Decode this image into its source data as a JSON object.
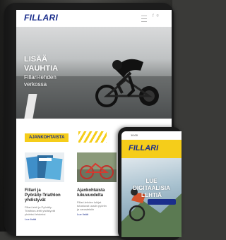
{
  "tablet": {
    "logo": "FILLARI",
    "social_icons": "f ⌾",
    "hero": {
      "title_line1": "LISÄÄ",
      "title_line2": "VAUHTIA",
      "subtitle_line1": "Fillari-lehden",
      "subtitle_line2": "verkossa"
    },
    "section_tag": "AJANKOHTAISTA",
    "cards": [
      {
        "title_line1": "Fillari ja",
        "title_line2": "Pyöräily-Triathlon",
        "title_line3": "yhdistyvät",
        "meta": "",
        "text_line1": "Fillari-lehti ja Pyöräily-",
        "text_line2": "Triathlon-lehti yhdistyvät",
        "text_line3": "yhdeksi lehdeksi",
        "link": "Lue lisää"
      },
      {
        "title_line1": "Ajankohtaista",
        "title_line2": "lukuvuodelta",
        "title_line3": "",
        "meta": "",
        "text_line1": "Fillari-lehden lukijat",
        "text_line2": "tutustuvat uusiin pyöriin",
        "text_line3": "ja varusteisiin",
        "link": "Lue lisää"
      }
    ]
  },
  "phone": {
    "status_time": "10:00",
    "logo": "FILLARI",
    "hero_line1": "LUE",
    "hero_line2": "DIGITAALISIA",
    "hero_line3": "LEHTIÄ"
  },
  "colors": {
    "brand_blue": "#1b2e8c",
    "accent_yellow": "#f5cd1a"
  }
}
